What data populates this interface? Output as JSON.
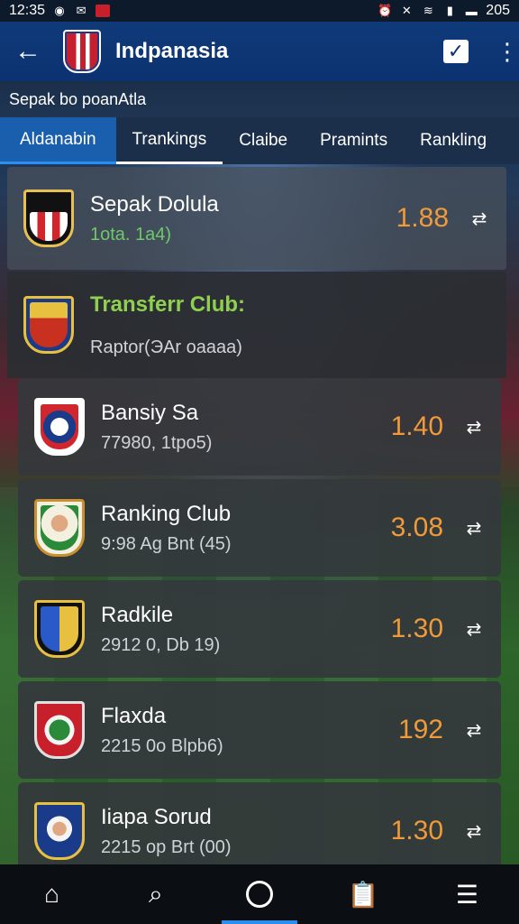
{
  "status": {
    "time": "12:35",
    "battery": "205"
  },
  "appbar": {
    "title": "Indpanasia",
    "back_icon": "arrow-left-icon",
    "check_icon": "check-box-icon",
    "more_icon": "more-vert-icon"
  },
  "subheader": {
    "text": "Sepak bo poanAtla"
  },
  "tabs": [
    {
      "label": "Aldanabin"
    },
    {
      "label": "Trankings"
    },
    {
      "label": "Claibe"
    },
    {
      "label": "Pramints"
    },
    {
      "label": "Rankling"
    }
  ],
  "rows": [
    {
      "name": "Sepak Dolula",
      "sub": "1ota. 1a4)",
      "rating": "1.88"
    },
    {
      "name": "Transferr Club:",
      "sub": "Raptor(ЭAr oaaaa)"
    },
    {
      "name": "Bansiy Sa",
      "sub": "77980, 1tpo5)",
      "rating": "1.40"
    },
    {
      "name": "Ranking Club",
      "sub": "9:98 Ag Bnt (45)",
      "rating": "3.08"
    },
    {
      "name": "Radkile",
      "sub": "2912 0, Db 19)",
      "rating": "1.30"
    },
    {
      "name": "Flaxda",
      "sub": "2215 0o Blpb6)",
      "rating": "192"
    },
    {
      "name": "Iiapa Sorud",
      "sub": "2215 op Brt (00)",
      "rating": "1.30"
    }
  ],
  "colors": {
    "appbar": "#0c3270",
    "accent": "#2a8ef0",
    "rating": "#f09a3a",
    "highlight": "#8fd050"
  },
  "nav": [
    {
      "icon": "home-icon"
    },
    {
      "icon": "search-icon"
    },
    {
      "icon": "circle-icon"
    },
    {
      "icon": "clipboard-icon"
    },
    {
      "icon": "list-icon"
    }
  ]
}
